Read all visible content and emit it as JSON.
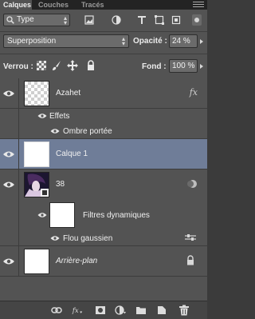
{
  "tabs": [
    {
      "label": "Calques",
      "active": true
    },
    {
      "label": "Couches",
      "active": false
    },
    {
      "label": "Tracés",
      "active": false
    }
  ],
  "filter": {
    "type_label": "Type"
  },
  "blend": {
    "mode": "Superposition",
    "opacity_label": "Opacité :",
    "opacity_value": "24 %"
  },
  "lock": {
    "label": "Verrou :",
    "fill_label": "Fond :",
    "fill_value": "100 %"
  },
  "layers": {
    "azahet": {
      "name": "Azahet",
      "effects_label": "Effets",
      "effect_1": "Ombre portée"
    },
    "calque1": {
      "name": "Calque 1"
    },
    "l38": {
      "name": "38",
      "smart_filters_label": "Filtres dynamiques",
      "filter_1": "Flou gaussien"
    },
    "background": {
      "name": "Arrière-plan"
    }
  },
  "colors": {
    "panel": "#535353",
    "selected_row": "#6f7d98",
    "tabbar": "#232323"
  }
}
